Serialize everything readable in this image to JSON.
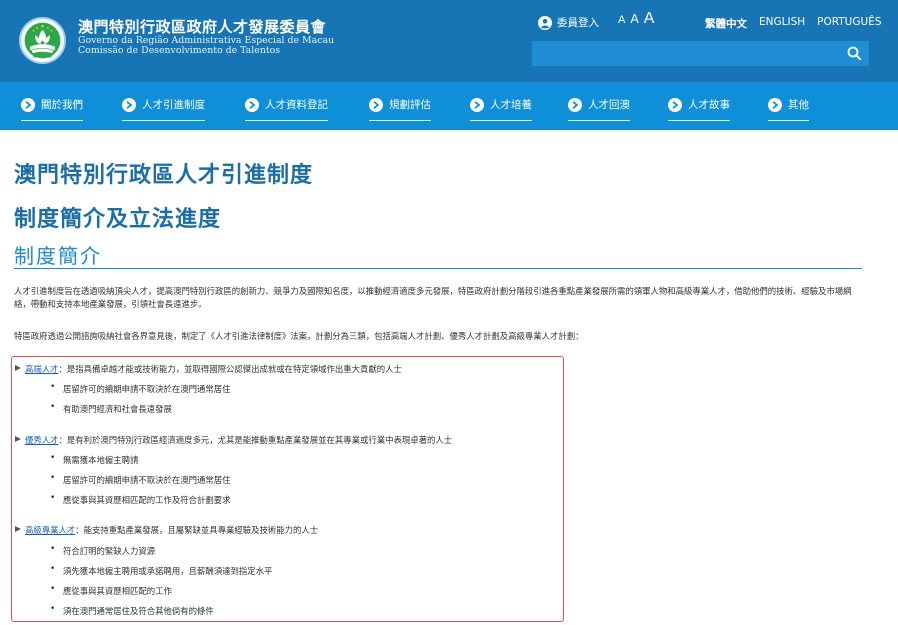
{
  "header": {
    "org_name": "澳門特別行政區政府人才發展委員會",
    "org_sub_pt": "Governo da Região Administrativa Especial de Macau",
    "org_sub_pt2": "Comissão de Desenvolvimento de Talentos",
    "member_login": "委員登入",
    "font_sizes": [
      "A",
      "A",
      "A"
    ],
    "languages": [
      "繁體中文",
      "ENGLISH",
      "PORTUGUÊS"
    ],
    "search_placeholder": "",
    "colors": {
      "header_bg": "#1775b5",
      "nav_bg": "#0e8fd8",
      "title": "#1c6ea6",
      "box_border": "#d9534f",
      "link": "#1a5fb4"
    }
  },
  "nav": [
    {
      "label": "關於我們"
    },
    {
      "label": "人才引進制度"
    },
    {
      "label": "人才資料登記"
    },
    {
      "label": "規劃評估"
    },
    {
      "label": "人才培養"
    },
    {
      "label": "人才回澳"
    },
    {
      "label": "人才故事"
    },
    {
      "label": "其他"
    }
  ],
  "main": {
    "title1": "澳門特別行政區人才引進制度",
    "title2": "制度簡介及立法進度",
    "section_title": "制度簡介",
    "para1": "人才引進制度旨在透過吸納頂尖人才，提高澳門特別行政區的創新力、競爭力及國際知名度，以推動經濟適度多元發展，特區政府計劃分階段引進各重點產業發展所需的領軍人物和高級專業人才，借助他們的技術、經驗及市場網絡，帶動和支持本地產業發展，引領社會長遠進步。",
    "para2": "特區政府透過公開諮詢吸納社會各界意見後，制定了《人才引進法律制度》法案，計劃分為三類，包括高端人才計劃、優秀人才計劃及高級專業人才計劃：",
    "categories": [
      {
        "name": "高端人才",
        "desc": "：是指具備卓越才能或技術能力，並取得國際公認傑出成就或在特定領域作出重大貢獻的人士",
        "bullets": [
          "居留許可的續期申請不取決於在澳門通常居住",
          "有助澳門經濟和社會長遠發展"
        ]
      },
      {
        "name": "優秀人才",
        "desc": "：是有利於澳門特別行政區經濟適度多元，尤其是能推動重點產業發展並在其專業或行業中表現卓著的人士",
        "bullets": [
          "無需獲本地僱主聘請",
          "居留許可的續期申請不取決於在澳門通常居住",
          "應從事與其資歷相匹配的工作及符合計劃要求"
        ]
      },
      {
        "name": "高級專業人才",
        "desc": "：能支持重點產業發展，且屬緊缺並具專業經驗及技術能力的人士",
        "bullets": [
          "符合訂明的緊缺人力資源",
          "須先獲本地僱主聘用或承諾聘用，且薪酬須達到指定水平",
          "應從事與其資歷相匹配的工作",
          "須在澳門通常居住及符合其他倘有的條件"
        ]
      }
    ]
  }
}
